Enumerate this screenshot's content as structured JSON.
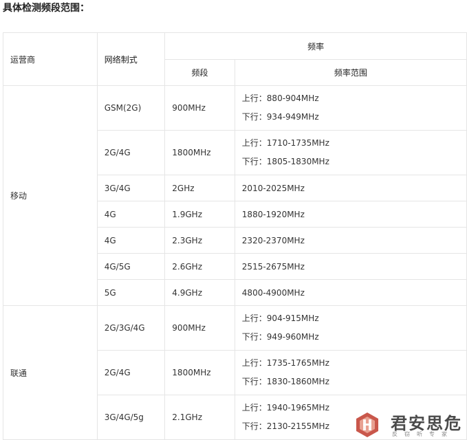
{
  "heading": "具体检测频段范围：",
  "table": {
    "header": {
      "operator": "运营商",
      "network": "网络制式",
      "frequency": "频率",
      "band": "频段",
      "range": "频率范围"
    },
    "groups": [
      {
        "operator": "移动",
        "rows": [
          {
            "network": "GSM(2G)",
            "band": "900MHz",
            "ranges": [
              "上行：880-904MHz",
              "下行：934-949MHz"
            ]
          },
          {
            "network": "2G/4G",
            "band": "1800MHz",
            "ranges": [
              "上行：1710-1735MHz",
              "下行：1805-1830MHz"
            ]
          },
          {
            "network": "3G/4G",
            "band": "2GHz",
            "ranges": [
              "2010-2025MHz"
            ]
          },
          {
            "network": "4G",
            "band": "1.9GHz",
            "ranges": [
              "1880-1920MHz"
            ]
          },
          {
            "network": "4G",
            "band": "2.3GHz",
            "ranges": [
              "2320-2370MHz"
            ]
          },
          {
            "network": "4G/5G",
            "band": "2.6GHz",
            "ranges": [
              "2515-2675MHz"
            ]
          },
          {
            "network": "5G",
            "band": "4.9GHz",
            "ranges": [
              "4800-4900MHz"
            ]
          }
        ]
      },
      {
        "operator": "联通",
        "rows": [
          {
            "network": "2G/3G/4G",
            "band": "900MHz",
            "ranges": [
              "上行：904-915MHz",
              "下行：949-960MHz"
            ]
          },
          {
            "network": "2G/4G",
            "band": "1800MHz",
            "ranges": [
              "上行：1735-1765MHz",
              "下行：1830-1860MHz"
            ]
          },
          {
            "network": "3G/4G/5g",
            "band": "2.1GHz",
            "ranges": [
              "上行：1940-1965MHz",
              "下行：2130-2155MHz"
            ]
          }
        ]
      }
    ]
  },
  "watermark": {
    "title": "君安思危",
    "subtitle": "反窃听专家",
    "logo_color": "#c0392b"
  }
}
